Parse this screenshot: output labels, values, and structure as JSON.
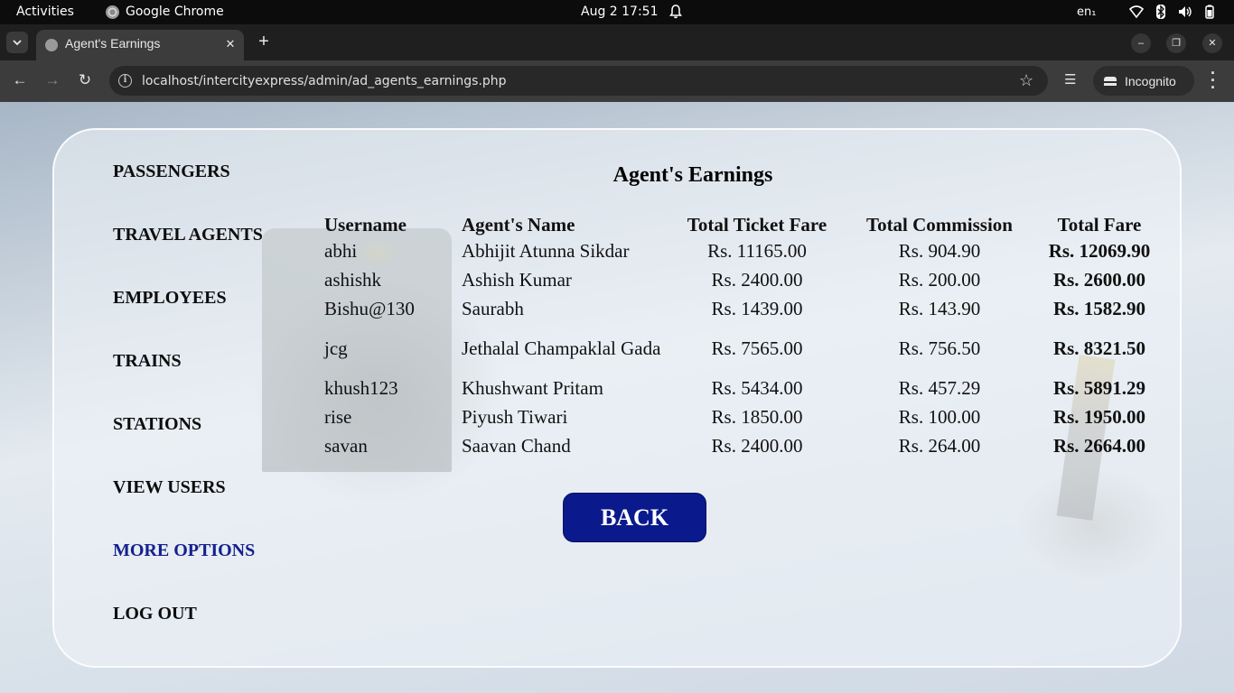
{
  "system": {
    "activities": "Activities",
    "app_name": "Google Chrome",
    "clock": "Aug 2  17:51",
    "lang": "en₁"
  },
  "browser": {
    "tab_title": "Agent's Earnings",
    "url": "localhost/intercityexpress/admin/ad_agents_earnings.php",
    "incognito_label": "Incognito"
  },
  "sidebar": {
    "items": [
      {
        "label": "PASSENGERS"
      },
      {
        "label": "TRAVEL AGENTS"
      },
      {
        "label": "EMPLOYEES"
      },
      {
        "label": "TRAINS"
      },
      {
        "label": "STATIONS"
      },
      {
        "label": "VIEW USERS"
      },
      {
        "label": "MORE OPTIONS",
        "active": true
      },
      {
        "label": "LOG OUT"
      }
    ],
    "active_color": "#15218e"
  },
  "earnings": {
    "title": "Agent's Earnings",
    "columns": [
      "Username",
      "Agent's Name",
      "Total Ticket Fare",
      "Total Commission",
      "Total Fare"
    ],
    "rows": [
      {
        "username": "abhi",
        "name": "Abhijit Atunna Sikdar",
        "ticket_fare": "Rs. 11165.00",
        "commission": "Rs. 904.90",
        "total": "Rs. 12069.90"
      },
      {
        "username": "ashishk",
        "name": "Ashish Kumar",
        "ticket_fare": "Rs. 2400.00",
        "commission": "Rs. 200.00",
        "total": "Rs. 2600.00"
      },
      {
        "username": "Bishu@130",
        "name": "Saurabh",
        "ticket_fare": "Rs. 1439.00",
        "commission": "Rs. 143.90",
        "total": "Rs. 1582.90"
      },
      {
        "username": "jcg",
        "name": "Jethalal Champaklal Gada",
        "ticket_fare": "Rs. 7565.00",
        "commission": "Rs. 756.50",
        "total": "Rs. 8321.50"
      },
      {
        "username": "khush123",
        "name": "Khushwant Pritam",
        "ticket_fare": "Rs. 5434.00",
        "commission": "Rs. 457.29",
        "total": "Rs. 5891.29"
      },
      {
        "username": "rise",
        "name": "Piyush Tiwari",
        "ticket_fare": "Rs. 1850.00",
        "commission": "Rs. 100.00",
        "total": "Rs. 1950.00"
      },
      {
        "username": "savan",
        "name": "Saavan Chand",
        "ticket_fare": "Rs. 2400.00",
        "commission": "Rs. 264.00",
        "total": "Rs. 2664.00"
      }
    ]
  },
  "back_button": {
    "label": "BACK",
    "color": "#0a1a8c"
  }
}
